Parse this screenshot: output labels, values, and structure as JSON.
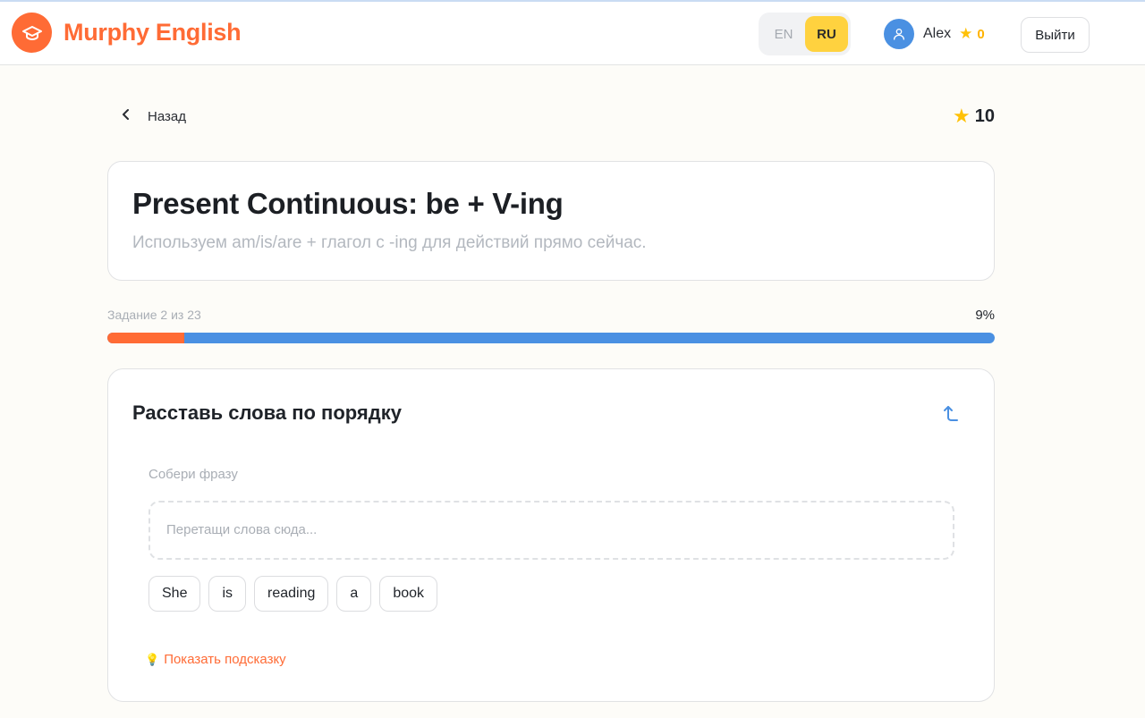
{
  "brand": {
    "name": "Murphy English",
    "logo_icon": "graduation-cap-icon",
    "color": "#ff6b35"
  },
  "header": {
    "languages": [
      {
        "code": "EN",
        "active": false
      },
      {
        "code": "RU",
        "active": true
      }
    ],
    "user": {
      "name": "Alex",
      "points": "0"
    },
    "logout_label": "Выйти"
  },
  "nav": {
    "back_label": "Назад",
    "score": "10"
  },
  "topic": {
    "title": "Present Continuous: be + V-ing",
    "subtitle": "Используем am/is/are + глагол с -ing для действий прямо сейчас."
  },
  "progress": {
    "label": "Задание 2 из 23",
    "percent_label": "9%",
    "fraction": 0.087
  },
  "task": {
    "title": "Расставь слова по порядку",
    "assemble_label": "Собери фразу",
    "dropzone_placeholder": "Перетащи слова сюда...",
    "words": [
      "She",
      "is",
      "reading",
      "a",
      "book"
    ],
    "hint_icon": "💡",
    "hint_label": "Показать подсказку"
  },
  "colors": {
    "accent": "#ff6b35",
    "primary": "#4a90e2",
    "highlight": "#ffd23f",
    "star": "#ffc107"
  }
}
